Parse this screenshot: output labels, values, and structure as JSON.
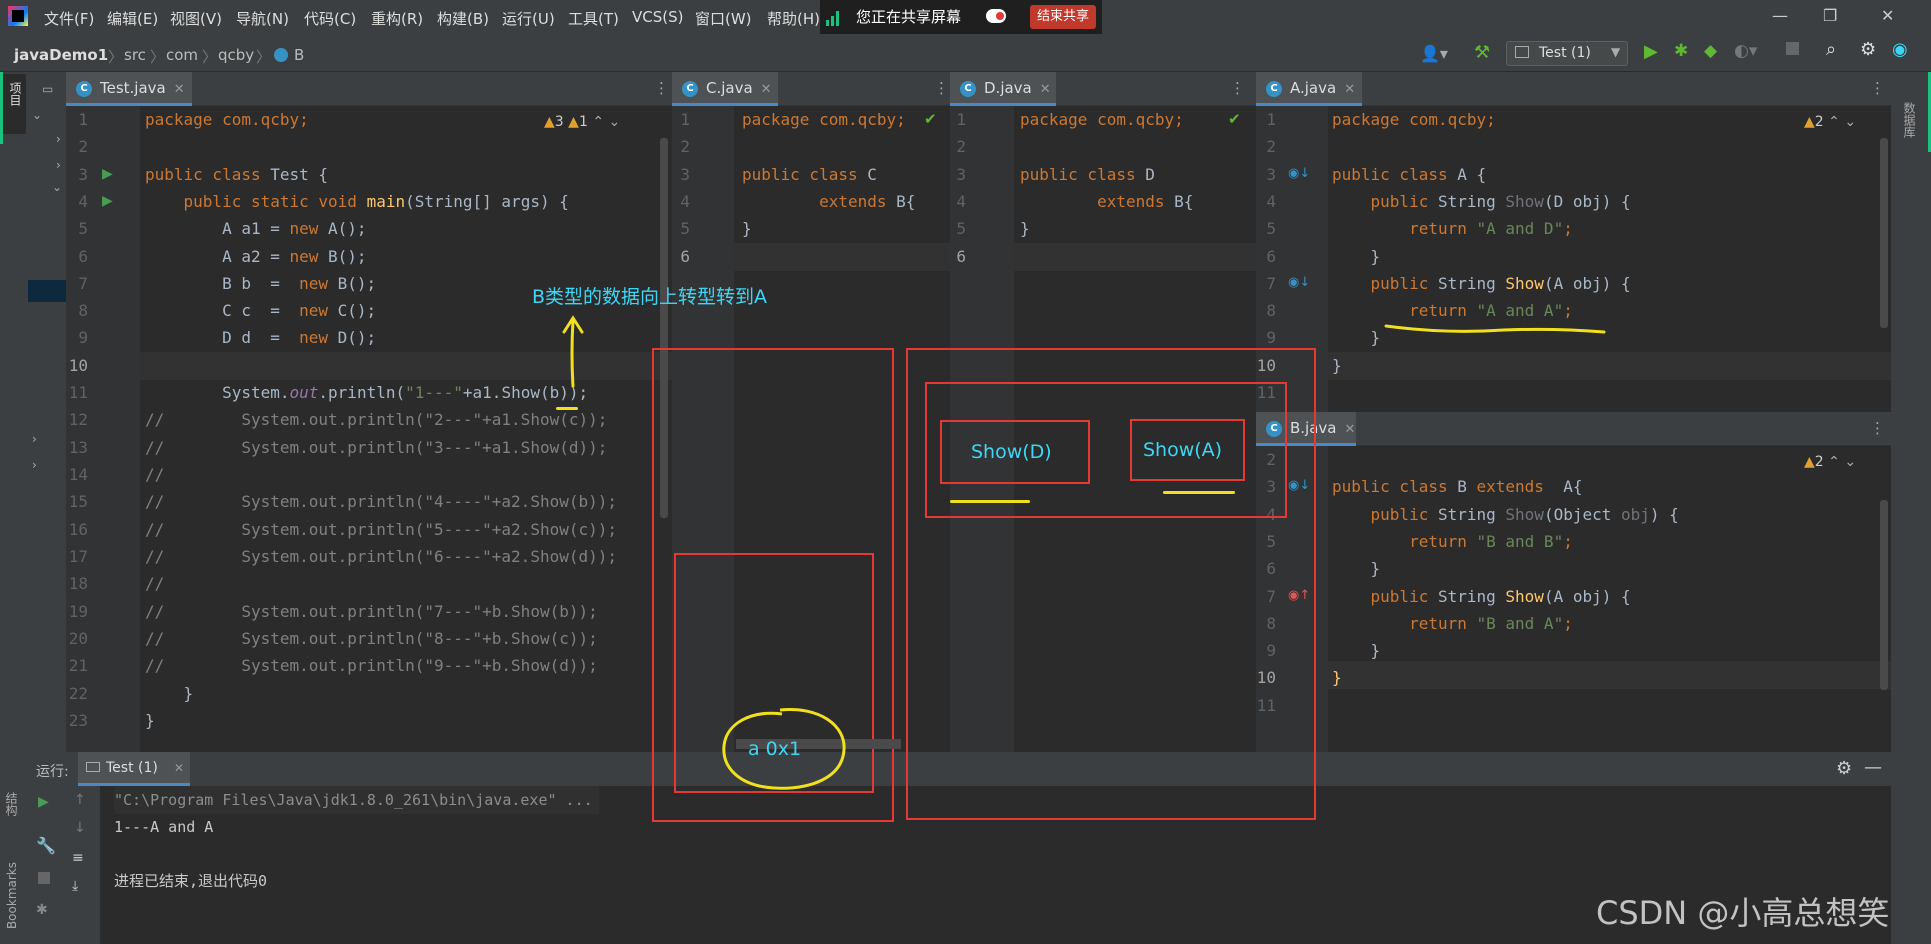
{
  "menu": [
    "文件(F)",
    "编辑(E)",
    "视图(V)",
    "导航(N)",
    "代码(C)",
    "重构(R)",
    "构建(B)",
    "运行(U)",
    "工具(T)",
    "VCS(S)",
    "窗口(W)",
    "帮助(H)"
  ],
  "share": {
    "status": "您正在共享屏幕",
    "end_button": "结束共享"
  },
  "breadcrumb": [
    "javaDemo1",
    "src",
    "com",
    "qcby",
    "B"
  ],
  "run_config": "Test (1)",
  "side_labels": {
    "project": "项目",
    "database": "数据库",
    "bookmarks": "Bookmarks",
    "structure": "结构"
  },
  "tabs": {
    "test": "Test.java",
    "c": "C.java",
    "d": "D.java",
    "a": "A.java",
    "b": "B.java"
  },
  "warnings": {
    "test_warn": "3",
    "test_weak": "1",
    "a_warn": "2",
    "b_warn": "2"
  },
  "test_code": {
    "l1": "package com.qcby;",
    "l3a": "public class ",
    "l3b": "Test {",
    "l4a": "    public static void ",
    "l4b": "main",
    "l4c": "(String[] args) {",
    "l5a": "        A a1 = ",
    "l5b": "new ",
    "l5c": "A();",
    "l6a": "        A a2 = ",
    "l6b": "new ",
    "l6c": "B();",
    "l7a": "        B b  =  ",
    "l7b": "new ",
    "l7c": "B();",
    "l8a": "        C c  =  ",
    "l8b": "new ",
    "l8c": "C();",
    "l9a": "        D d  =  ",
    "l9b": "new ",
    "l9c": "D();",
    "l11a": "        System.",
    "l11b": "out",
    "l11c": ".println(",
    "l11d": "\"1---\"",
    "l11e": "+a1.Show(b));",
    "l12": "//        System.out.println(\"2---\"+a1.Show(c));",
    "l13": "//        System.out.println(\"3---\"+a1.Show(d));",
    "l14": "//",
    "l15": "//        System.out.println(\"4----\"+a2.Show(b));",
    "l16": "//        System.out.println(\"5----\"+a2.Show(c));",
    "l17": "//        System.out.println(\"6----\"+a2.Show(d));",
    "l18": "//",
    "l19": "//        System.out.println(\"7---\"+b.Show(b));",
    "l20": "//        System.out.println(\"8---\"+b.Show(c));",
    "l21": "//        System.out.println(\"9---\"+b.Show(d));",
    "l22": "    }",
    "l23": "}"
  },
  "c_code": {
    "l1": "package com.qcby;",
    "l3a": "public class ",
    "l3b": "C",
    "l4a": "        extends ",
    "l4b": "B{",
    "l5": "}"
  },
  "d_code": {
    "l1": "package com.qcby;",
    "l3a": "public class ",
    "l3b": "D",
    "l4a": "        extends ",
    "l4b": "B{",
    "l5": "}"
  },
  "a_code": {
    "l1": "package com.qcby;",
    "l3a": "public class ",
    "l3b": "A {",
    "l4a": "    public ",
    "l4b": "String ",
    "l4c": "Show",
    "l4d": "(D obj) {",
    "l5a": "        return ",
    "l5b": "\"A and D\"",
    "l5c": ";",
    "l6": "    }",
    "l7a": "    public ",
    "l7b": "String ",
    "l7c": "Show",
    "l7d": "(A obj) {",
    "l8a": "        return ",
    "l8b": "\"A and A\"",
    "l8c": ";",
    "l9": "    }",
    "l10": "}"
  },
  "b_code": {
    "l3a": "public class ",
    "l3b": "B ",
    "l3c": "extends ",
    "l3d": " A{",
    "l4a": "    public ",
    "l4b": "String ",
    "l4c": "Show",
    "l4d": "(Object ",
    "l4e": "obj",
    "l4f": ") {",
    "l5a": "        return ",
    "l5b": "\"B and B\"",
    "l5c": ";",
    "l6": "    }",
    "l7a": "    public ",
    "l7b": "String ",
    "l7c": "Show",
    "l7d": "(A obj) {",
    "l8a": "        return ",
    "l8b": "\"B and A\"",
    "l8c": ";",
    "l9": "    }",
    "l10": "}"
  },
  "run": {
    "label": "运行:",
    "tab": "Test (1)",
    "cmd": "\"C:\\Program Files\\Java\\jdk1.8.0_261\\bin\\java.exe\" ...",
    "out1": "1---A and A",
    "out2": "进程已结束,退出代码0"
  },
  "annotations": {
    "upcast": "B类型的数据向上转型转到A",
    "show_d": "Show(D)",
    "show_a": "Show(A)",
    "ref": "a 0x1"
  },
  "watermark": "CSDN @小高总想笑"
}
